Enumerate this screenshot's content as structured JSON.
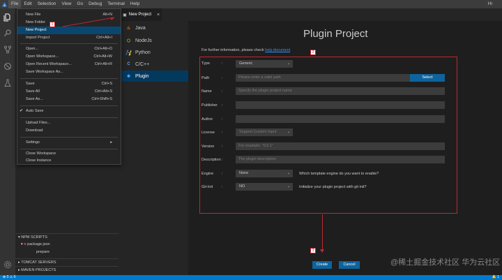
{
  "menubar": {
    "items": [
      "File",
      "Edit",
      "Selection",
      "View",
      "Go",
      "Debug",
      "Terminal",
      "Help"
    ],
    "user": "Hi"
  },
  "file_menu": {
    "items": [
      {
        "label": "New File",
        "shortcut": "Alt+N"
      },
      {
        "label": "New Folder",
        "shortcut": ""
      },
      {
        "label": "New Project",
        "shortcut": ""
      },
      {
        "label": "Import Project",
        "shortcut": "Ctrl+Alt+I"
      },
      {
        "label": "Open...",
        "shortcut": "Ctrl+Alt+O"
      },
      {
        "label": "Open Workspace...",
        "shortcut": "Ctrl+Alt+W"
      },
      {
        "label": "Open Recent Workspace...",
        "shortcut": "Ctrl+Alt+R"
      },
      {
        "label": "Save Workspace As...",
        "shortcut": ""
      },
      {
        "label": "Save",
        "shortcut": "Ctrl+S"
      },
      {
        "label": "Save All",
        "shortcut": "Ctrl+Alt+S"
      },
      {
        "label": "Save As...",
        "shortcut": "Ctrl+Shift+S"
      },
      {
        "label": "Auto Save",
        "shortcut": ""
      },
      {
        "label": "Upload Files...",
        "shortcut": ""
      },
      {
        "label": "Download",
        "shortcut": ""
      },
      {
        "label": "Settings",
        "shortcut": ""
      },
      {
        "label": "Close Workspace",
        "shortcut": ""
      },
      {
        "label": "Close Instance",
        "shortcut": ""
      }
    ],
    "check": "✔",
    "submenu_arrow": "▸"
  },
  "sidebar": {
    "npm_scripts": "NPM SCRIPTS",
    "package": "package.json",
    "script": "prepare",
    "tomcat": "TOMCAT SERVERS",
    "maven": "MAVEN PROJECTS"
  },
  "tab": {
    "label": "New Project",
    "close": "×"
  },
  "project_types": [
    "Java",
    "NodeJs",
    "Python",
    "C/C++",
    "Plugin"
  ],
  "form": {
    "title": "Plugin Project",
    "info_text": "For further information, please check",
    "info_link": "help document",
    "colon": ":",
    "type": {
      "label": "Type",
      "value": "Generic"
    },
    "path": {
      "label": "Path",
      "placeholder": "Please enter a valid path",
      "button": "Select"
    },
    "name": {
      "label": "Name",
      "placeholder": "Specify the plugin project name"
    },
    "publisher": {
      "label": "Publisher"
    },
    "author": {
      "label": "Author"
    },
    "license": {
      "label": "License",
      "value": "Support Custom Input"
    },
    "version": {
      "label": "Version",
      "placeholder": "For example: \"0.0.1\""
    },
    "description": {
      "label": "Description",
      "placeholder": "The plugin description"
    },
    "engine": {
      "label": "Engine",
      "value": "None",
      "hint": "Which template engine do you want to enable?"
    },
    "gitinit": {
      "label": "Git-Init",
      "value": "NO",
      "hint": "Initialize your plugin project with git init?"
    },
    "create": "Create",
    "cancel": "Cancel"
  },
  "markers": [
    "1",
    "2",
    "3"
  ],
  "status": {
    "left": "⊗ 0 ⚠ 0",
    "right": "🔔 1"
  },
  "watermark": "@稀土掘金技术社区 华为云社区",
  "colors": {
    "accent": "#0e639c",
    "highlight": "#c0282e",
    "status": "#007acc"
  }
}
